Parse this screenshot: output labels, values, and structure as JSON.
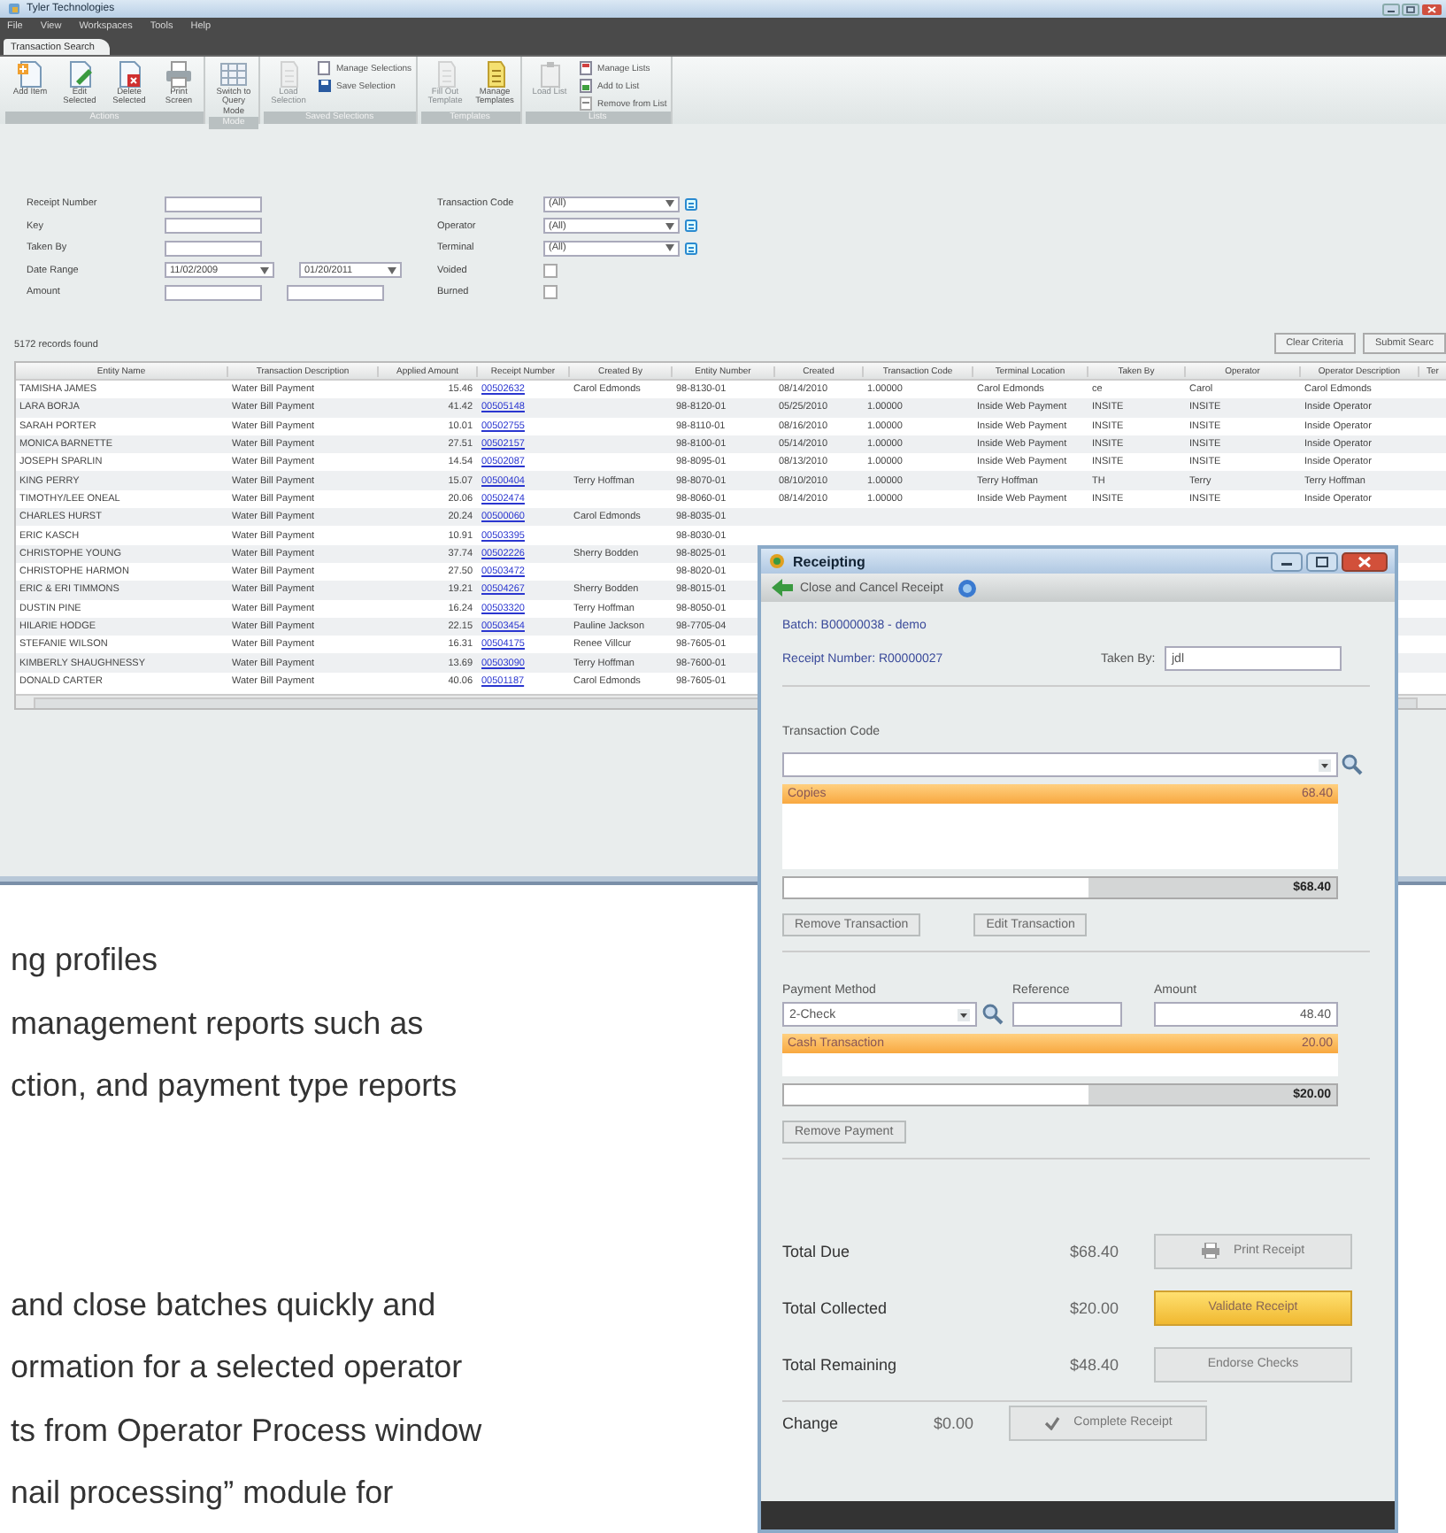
{
  "app": {
    "title": "Tyler Technologies",
    "menu": [
      "File",
      "View",
      "Workspaces",
      "Tools",
      "Help"
    ],
    "tabs": [
      {
        "label": "Transaction Search",
        "selected": true
      }
    ],
    "ribbon_groups": [
      {
        "label": "Actions",
        "items": [
          {
            "kind": "large",
            "label": "Add Item",
            "disabled": false
          },
          {
            "kind": "large",
            "label": "Edit Selected",
            "disabled": false
          },
          {
            "kind": "large",
            "label": "Delete Selected",
            "disabled": false
          },
          {
            "kind": "large",
            "label": "Print Screen",
            "disabled": false
          }
        ]
      },
      {
        "label": "Mode",
        "items": [
          {
            "kind": "large",
            "label": "Switch to Query Mode",
            "disabled": false
          }
        ]
      },
      {
        "label": "Saved Selections",
        "items": [
          {
            "kind": "large",
            "label": "Load Selection",
            "disabled": true
          },
          {
            "kind": "small",
            "label": "Manage Selections",
            "disabled": false
          },
          {
            "kind": "small",
            "label": "Save Selection",
            "disabled": false
          }
        ]
      },
      {
        "label": "Templates",
        "items": [
          {
            "kind": "large",
            "label": "Fill Out Template",
            "disabled": true
          },
          {
            "kind": "large",
            "label": "Manage Templates",
            "disabled": false
          }
        ]
      },
      {
        "label": "Lists",
        "items": [
          {
            "kind": "large",
            "label": "Load List",
            "disabled": true
          },
          {
            "kind": "small",
            "label": "Manage Lists",
            "disabled": false
          },
          {
            "kind": "small",
            "label": "Add to List",
            "disabled": false
          },
          {
            "kind": "small",
            "label": "Remove from List",
            "disabled": false
          }
        ]
      }
    ],
    "criteria_left": [
      {
        "label": "Receipt Number",
        "fields": [
          {
            "kind": "text"
          }
        ]
      },
      {
        "label": "Key",
        "fields": [
          {
            "kind": "text"
          }
        ]
      },
      {
        "label": "Taken By",
        "fields": [
          {
            "kind": "text"
          }
        ]
      },
      {
        "label": "Date Range",
        "fields": [
          {
            "kind": "date",
            "value": "11/02/2009"
          },
          {
            "kind": "date",
            "value": "01/20/2011"
          }
        ]
      },
      {
        "label": "Amount",
        "fields": [
          {
            "kind": "text"
          },
          {
            "kind": "text"
          }
        ]
      }
    ],
    "criteria_right": [
      {
        "label": "Transaction Code",
        "kind": "combo",
        "value": "(All)"
      },
      {
        "label": "Operator",
        "kind": "combo",
        "value": "(All)"
      },
      {
        "label": "Terminal",
        "kind": "combo",
        "value": "(All)"
      },
      {
        "label": "Voided",
        "kind": "checkbox",
        "checked": false
      },
      {
        "label": "Burned",
        "kind": "checkbox",
        "checked": false
      }
    ],
    "records_found": "5172 records found",
    "buttons": [
      "Clear Criteria",
      "Submit Searc"
    ],
    "table": {
      "columns": [
        "Entity Name",
        "Transaction Description",
        "Applied Amount",
        "Receipt Number",
        "Created By",
        "Entity Number",
        "Created",
        "Transaction Code",
        "Terminal Location",
        "Taken By",
        "Operator",
        "Operator Description",
        "Ter"
      ],
      "rows": [
        [
          "TAMISHA JAMES",
          "Water Bill Payment",
          "15.46",
          "00502632",
          "Carol Edmonds",
          "98-8130-01",
          "08/14/2010",
          "1.00000",
          "Carol Edmonds",
          "ce",
          "Carol",
          "Carol Edmonds"
        ],
        [
          "LARA BORJA",
          "Water Bill Payment",
          "41.42",
          "00505148",
          "",
          "98-8120-01",
          "05/25/2010",
          "1.00000",
          "Inside Web Payment",
          "INSITE",
          "INSITE",
          "Inside Operator"
        ],
        [
          "SARAH PORTER",
          "Water Bill Payment",
          "10.01",
          "00502755",
          "",
          "98-8110-01",
          "08/16/2010",
          "1.00000",
          "Inside Web Payment",
          "INSITE",
          "INSITE",
          "Inside Operator"
        ],
        [
          "MONICA BARNETTE",
          "Water Bill Payment",
          "27.51",
          "00502157",
          "",
          "98-8100-01",
          "05/14/2010",
          "1.00000",
          "Inside Web Payment",
          "INSITE",
          "INSITE",
          "Inside Operator"
        ],
        [
          "JOSEPH SPARLIN",
          "Water Bill Payment",
          "14.54",
          "00502087",
          "",
          "98-8095-01",
          "08/13/2010",
          "1.00000",
          "Inside Web Payment",
          "INSITE",
          "INSITE",
          "Inside Operator"
        ],
        [
          "KING PERRY",
          "Water Bill Payment",
          "15.07",
          "00500404",
          "Terry Hoffman",
          "98-8070-01",
          "08/10/2010",
          "1.00000",
          "Terry Hoffman",
          "TH",
          "Terry",
          "Terry Hoffman"
        ],
        [
          "TIMOTHY/LEE ONEAL",
          "Water Bill Payment",
          "20.06",
          "00502474",
          "",
          "98-8060-01",
          "08/14/2010",
          "1.00000",
          "Inside Web Payment",
          "INSITE",
          "INSITE",
          "Inside Operator"
        ],
        [
          "CHARLES HURST",
          "Water Bill Payment",
          "20.24",
          "00500060",
          "Carol Edmonds",
          "98-8035-01"
        ],
        [
          "ERIC KASCH",
          "Water Bill Payment",
          "10.91",
          "00503395",
          "",
          "98-8030-01"
        ],
        [
          "CHRISTOPHE YOUNG",
          "Water Bill Payment",
          "37.74",
          "00502226",
          "Sherry Bodden",
          "98-8025-01"
        ],
        [
          "CHRISTOPHE HARMON",
          "Water Bill Payment",
          "27.50",
          "00503472",
          "",
          "98-8020-01"
        ],
        [
          "ERIC & ERI TIMMONS",
          "Water Bill Payment",
          "19.21",
          "00504267",
          "Sherry Bodden",
          "98-8015-01"
        ],
        [
          "DUSTIN PINE",
          "Water Bill Payment",
          "16.24",
          "00503320",
          "Terry Hoffman",
          "98-8050-01"
        ],
        [
          "HILARIE HODGE",
          "Water Bill Payment",
          "22.15",
          "00503454",
          "Pauline Jackson",
          "98-7705-04"
        ],
        [
          "STEFANIE WILSON",
          "Water Bill Payment",
          "16.31",
          "00504175",
          "Renee Villcur",
          "98-7605-01"
        ],
        [
          "KIMBERLY SHAUGHNESSY",
          "Water Bill Payment",
          "13.69",
          "00503090",
          "Terry Hoffman",
          "98-7600-01"
        ],
        [
          "DONALD CARTER",
          "Water Bill Payment",
          "40.06",
          "00501187",
          "Carol Edmonds",
          "98-7605-01"
        ]
      ]
    }
  },
  "text_blocks": [
    [
      "ng profiles",
      "management reports such as",
      "ction, and payment type reports"
    ],
    [
      "and close batches quickly and",
      "ormation for a selected operator",
      "ts from Operator Process window",
      "nail processing” module for"
    ]
  ],
  "receipting": {
    "title": "Receipting",
    "toolbar_label": "Close and Cancel Receipt",
    "batch": "Batch: B00000038 - demo",
    "receipt_number": "Receipt Number: R00000027",
    "taken_by": {
      "label": "Taken By:",
      "value": "jdl"
    },
    "transactions": {
      "label": "Transaction Code",
      "items": [
        {
          "name": "Copies",
          "amount": "68.40",
          "selected": true
        }
      ],
      "total": "$68.40",
      "buttons": [
        "Remove Transaction",
        "Edit Transaction"
      ]
    },
    "payments": {
      "columns": [
        "Payment Method",
        "Reference",
        "Amount"
      ],
      "method": "2-Check",
      "amount": "48.40",
      "items": [
        {
          "name": "Cash Transaction",
          "amount": "20.00",
          "selected": true
        }
      ],
      "total": "$20.00",
      "buttons": [
        "Remove Payment"
      ]
    },
    "totals": [
      {
        "label": "Total Due",
        "value": "$68.40",
        "action": {
          "label": "Print Receipt",
          "kind": "print"
        }
      },
      {
        "label": "Total Collected",
        "value": "$20.00",
        "action": {
          "label": "Validate Receipt",
          "kind": "default"
        }
      },
      {
        "label": "Total Remaining",
        "value": "$48.40",
        "action": {
          "label": "Endorse Checks",
          "kind": "plain"
        }
      },
      {
        "label": "Change",
        "value": "$0.00",
        "action": {
          "label": "Complete Receipt",
          "kind": "check"
        }
      }
    ]
  }
}
